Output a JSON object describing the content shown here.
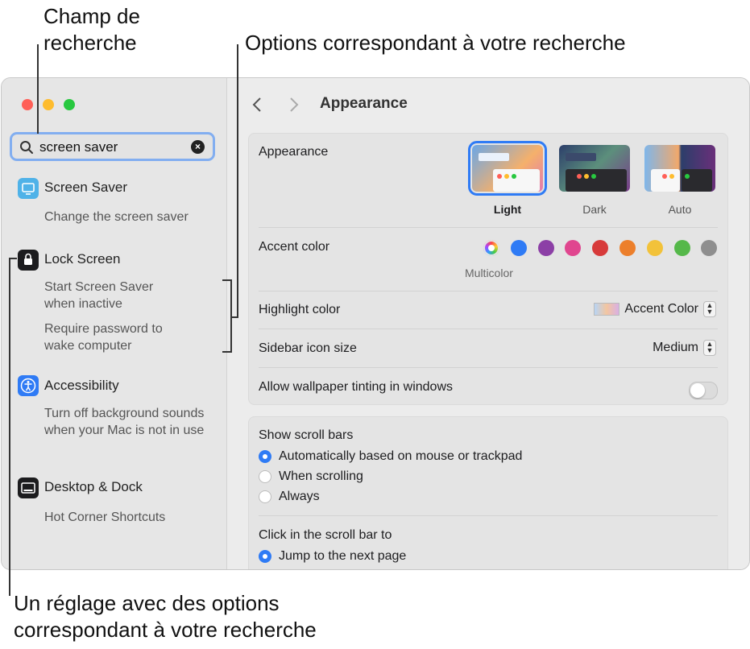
{
  "callouts": {
    "search_field": "Champ de\nrecherche",
    "matching_options": "Options correspondant à votre recherche",
    "setting_with_options": "Un réglage avec des options\ncorrespondant à votre recherche"
  },
  "search": {
    "value": "screen saver"
  },
  "sidebar": {
    "results": [
      {
        "title": "Screen Saver",
        "subs": [
          "Change the screen saver"
        ]
      },
      {
        "title": "Lock Screen",
        "subs": [
          "Start Screen Saver when inactive",
          "Require password to wake computer"
        ]
      },
      {
        "title": "Accessibility",
        "subs": [
          "Turn off background sounds when your Mac is not in use"
        ]
      },
      {
        "title": "Desktop & Dock",
        "subs": [
          "Hot Corner Shortcuts"
        ]
      }
    ]
  },
  "header": {
    "title": "Appearance"
  },
  "appearance": {
    "label": "Appearance",
    "options": [
      "Light",
      "Dark",
      "Auto"
    ],
    "selected": "Light"
  },
  "accent": {
    "label": "Accent color",
    "selected_name": "Multicolor",
    "colors": [
      "#8a5cf6",
      "#2f7bf5",
      "#8c3fa6",
      "#e0468f",
      "#d73a3a",
      "#ec7f2b",
      "#f2c23a",
      "#55b84a",
      "#8e8e8e"
    ]
  },
  "highlight": {
    "label": "Highlight color",
    "value": "Accent Color"
  },
  "icon_size": {
    "label": "Sidebar icon size",
    "value": "Medium"
  },
  "tinting": {
    "label": "Allow wallpaper tinting in windows",
    "on": false
  },
  "scrollbars": {
    "label": "Show scroll bars",
    "options": [
      "Automatically based on mouse or trackpad",
      "When scrolling",
      "Always"
    ],
    "selected": 0
  },
  "scroll_click": {
    "label": "Click in the scroll bar to",
    "options": [
      "Jump to the next page"
    ],
    "selected": 0
  }
}
